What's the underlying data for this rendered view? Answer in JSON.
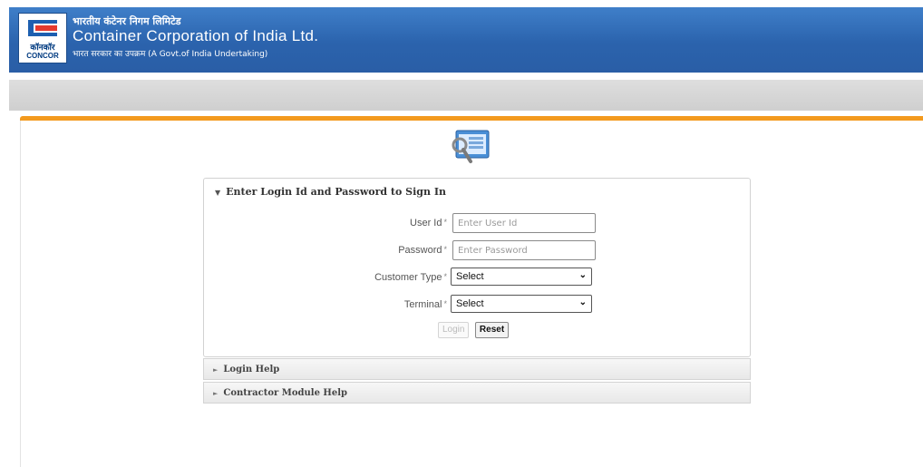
{
  "header": {
    "logo_hindi": "कॉनकॉर",
    "logo_text": "CONCOR",
    "org_name_hindi": "भारतीय कंटेनर निगम लिमिटेड",
    "org_name": "Container Corporation of India Ltd.",
    "org_subtitle": "भारत सरकार का उपक्रम (A Govt.of India Undertaking)"
  },
  "login": {
    "section_title": "Enter Login Id and Password to Sign In",
    "fields": {
      "user_id": {
        "label": "User Id",
        "required": "*",
        "placeholder": "Enter User Id"
      },
      "password": {
        "label": "Password",
        "required": "*",
        "placeholder": "Enter Password"
      },
      "customer_type": {
        "label": "Customer Type",
        "required": "*",
        "value": "Select"
      },
      "terminal": {
        "label": "Terminal",
        "required": "*",
        "value": "Select"
      }
    },
    "buttons": {
      "login": "Login",
      "reset": "Reset"
    }
  },
  "accordion": {
    "login_help": "Login Help",
    "contractor_help": "Contractor Module Help"
  },
  "colors": {
    "header_blue": "#2b63ad",
    "accent_orange": "#f39a1e"
  }
}
